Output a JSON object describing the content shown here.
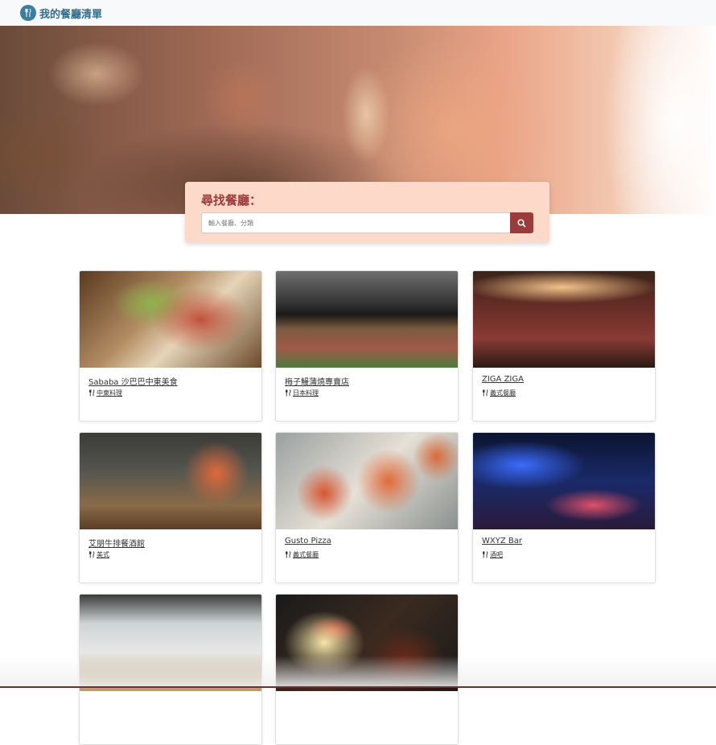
{
  "navbar": {
    "brand": "我的餐廳清單",
    "brand_icon": "utensils-icon"
  },
  "search": {
    "title": "尋找餐廳：",
    "placeholder": "輸入餐廳、分類",
    "value": "",
    "button_icon": "search-icon"
  },
  "colors": {
    "accent": "#9b3c3c",
    "search_card_bg": "#fcd9c8",
    "brand": "#2f6f8f"
  },
  "restaurants": [
    {
      "name": "Sababa 沙巴巴中東美食",
      "category": "中東料理"
    },
    {
      "name": "梅子鰻蒲燒專賣店",
      "category": "日本料理"
    },
    {
      "name": "ZIGA ZIGA",
      "category": "義式餐廳"
    },
    {
      "name": "艾朋牛排餐酒館",
      "category": "美式"
    },
    {
      "name": "Gusto Pizza",
      "category": "義式餐廳"
    },
    {
      "name": "WXYZ Bar",
      "category": "酒吧"
    },
    {
      "name": "",
      "category": ""
    },
    {
      "name": "",
      "category": ""
    }
  ]
}
